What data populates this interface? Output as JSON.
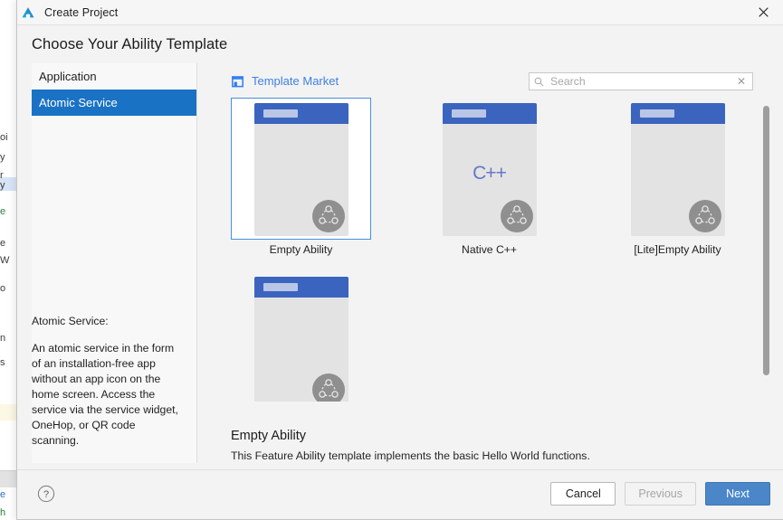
{
  "window": {
    "title": "Create Project",
    "app_icon": "deveco-logo-icon",
    "close_icon": "close-icon"
  },
  "heading": "Choose Your Ability Template",
  "sidebar": {
    "items": [
      {
        "label": "Application",
        "selected": false
      },
      {
        "label": "Atomic Service",
        "selected": true
      }
    ],
    "description": {
      "title": "Atomic Service:",
      "body": "An atomic service in the form of an installation-free app without an app icon on the home screen. Access the service via the service widget, OneHop, or QR code scanning."
    }
  },
  "market": {
    "icon": "shop-icon",
    "label": "Template Market"
  },
  "search": {
    "icon": "search-icon",
    "placeholder": "Search",
    "value": "",
    "clear_icon": "clear-icon"
  },
  "templates": [
    {
      "label": "Empty Ability",
      "selected": true,
      "center_glyph": "",
      "badge_icon": "atomic-service-icon"
    },
    {
      "label": "Native C++",
      "selected": false,
      "center_glyph": "C++",
      "badge_icon": "atomic-service-icon"
    },
    {
      "label": "[Lite]Empty Ability",
      "selected": false,
      "center_glyph": "",
      "badge_icon": "atomic-service-icon"
    },
    {
      "label": "",
      "selected": false,
      "center_glyph": "",
      "badge_icon": "atomic-service-icon"
    }
  ],
  "detail": {
    "title": "Empty Ability",
    "body": "This Feature Ability template implements the basic Hello World functions."
  },
  "footer": {
    "help_icon": "help-icon",
    "cancel_label": "Cancel",
    "previous_label": "Previous",
    "previous_disabled": true,
    "next_label": "Next"
  },
  "colors": {
    "accent_blue": "#1a72c4",
    "primary_button": "#4a86c8",
    "link_blue": "#3e7fe6",
    "card_header": "#3b64bf",
    "selection_border": "#4a90d9"
  },
  "backdrop": {
    "fragments": [
      "oi",
      "y",
      "r",
      "y",
      "e",
      "e",
      "W",
      "o",
      "n",
      "s",
      "e",
      "h"
    ]
  }
}
